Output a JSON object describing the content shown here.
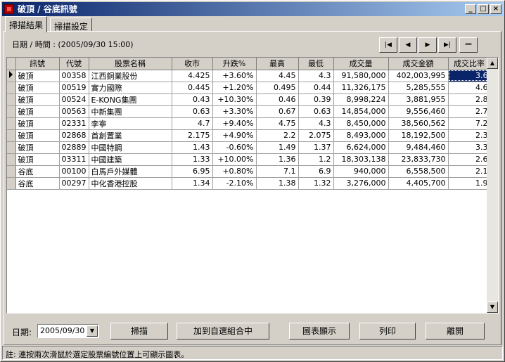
{
  "window": {
    "title": "破頂 / 谷底訊號"
  },
  "tabs": [
    {
      "label": "掃描結果",
      "active": true
    },
    {
      "label": "掃描設定",
      "active": false
    }
  ],
  "datetime": {
    "label": "日期 / 時間 :",
    "value": "(2005/09/30 15:00)"
  },
  "nav": {
    "first_icon": "first-page-icon",
    "prev_icon": "prev-icon",
    "next_icon": "next-icon",
    "last_icon": "last-page-icon",
    "minus_icon": "minus-icon"
  },
  "grid": {
    "columns": [
      "訊號",
      "代號",
      "股票名稱",
      "收市",
      "升跌%",
      "最高",
      "最低",
      "成交量",
      "成交金額",
      "成交比率"
    ],
    "rows": [
      [
        "破頂",
        "00358",
        "江西銅業股份",
        "4.425",
        "+3.60%",
        "4.45",
        "4.3",
        "91,580,000",
        "402,003,995",
        "3.6"
      ],
      [
        "破頂",
        "00519",
        "實力國際",
        "0.445",
        "+1.20%",
        "0.495",
        "0.44",
        "11,326,175",
        "5,285,555",
        "4.6"
      ],
      [
        "破頂",
        "00524",
        "E-KONG集團",
        "0.43",
        "+10.30%",
        "0.46",
        "0.39",
        "8,998,224",
        "3,881,955",
        "2.8"
      ],
      [
        "破頂",
        "00563",
        "中新集團",
        "0.63",
        "+3.30%",
        "0.67",
        "0.63",
        "14,854,000",
        "9,556,460",
        "2.7"
      ],
      [
        "破頂",
        "02331",
        "李寧",
        "4.7",
        "+9.40%",
        "4.75",
        "4.3",
        "8,450,000",
        "38,560,562",
        "7.2"
      ],
      [
        "破頂",
        "02868",
        "首創置業",
        "2.175",
        "+4.90%",
        "2.2",
        "2.075",
        "8,493,000",
        "18,192,500",
        "2.3"
      ],
      [
        "破頂",
        "02889",
        "中國特鋼",
        "1.43",
        "-0.60%",
        "1.49",
        "1.37",
        "6,624,000",
        "9,484,460",
        "3.3"
      ],
      [
        "破頂",
        "03311",
        "中國建築",
        "1.33",
        "+10.00%",
        "1.36",
        "1.2",
        "18,303,138",
        "23,833,730",
        "2.6"
      ],
      [
        "谷底",
        "00100",
        "白馬戶外媒體",
        "6.95",
        "+0.80%",
        "7.1",
        "6.9",
        "940,000",
        "6,558,500",
        "2.1"
      ],
      [
        "谷底",
        "00297",
        "中化香港控股",
        "1.34",
        "-2.10%",
        "1.38",
        "1.32",
        "3,276,000",
        "4,405,700",
        "1.9"
      ]
    ]
  },
  "bottom": {
    "date_label": "日期:",
    "date_value": "2005/09/30",
    "scan_label": "掃描",
    "add_label": "加到自選組合中",
    "chart_label": "圖表顯示",
    "print_label": "列印",
    "close_label": "離開"
  },
  "status": {
    "text": "註: 連按兩次滑鼠於選定股票編號位置上可顯示圖表。"
  }
}
